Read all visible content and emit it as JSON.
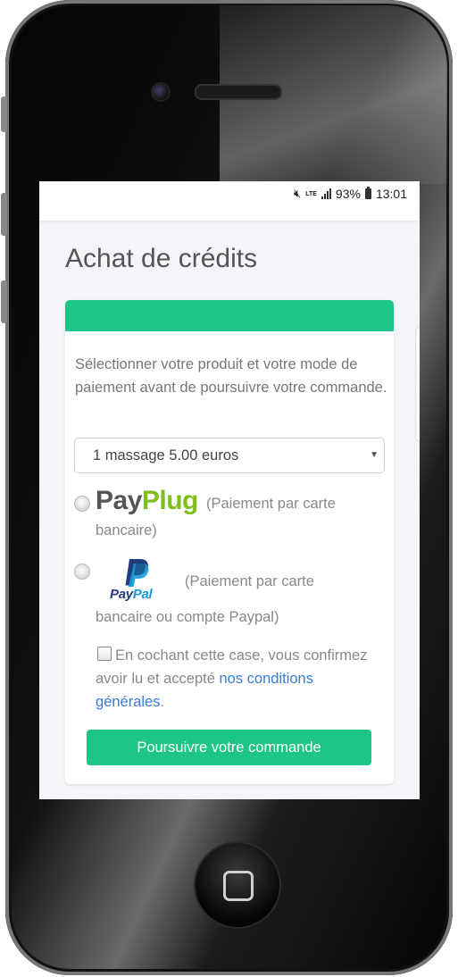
{
  "status_bar": {
    "mute_icon": "mute-icon",
    "network": "LTE",
    "battery": "93%",
    "time": "13:01"
  },
  "page": {
    "title": "Achat de crédits"
  },
  "card": {
    "accent_color": "#1dc588",
    "intro_text": "Sélectionner votre produit et votre mode de paiement avant de poursuivre votre commande.",
    "product_select": {
      "selected": "1 massage 5.00 euros"
    },
    "payment_methods": [
      {
        "logo_pay": "Pay",
        "logo_plug": "Plug",
        "description_line1": "(Paiement par carte",
        "description_line2": "bancaire)"
      },
      {
        "logo_pay": "Pay",
        "logo_pal": "Pal",
        "description_line1": "(Paiement par carte",
        "description_line2": "bancaire ou compte Paypal)"
      }
    ],
    "consent": {
      "text": "En cochant cette case, vous confirmez avoir lu et accepté ",
      "link_text": "nos conditions générales",
      "suffix": "."
    },
    "submit_label": "Poursuivre votre commande"
  }
}
